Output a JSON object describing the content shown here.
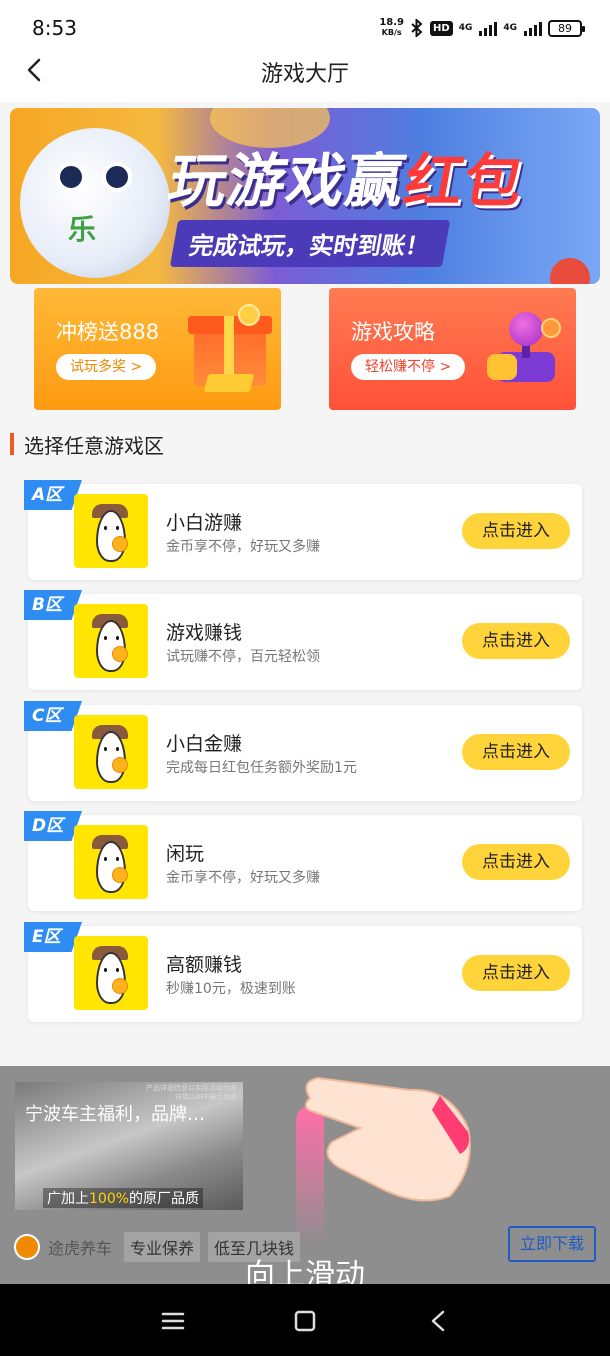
{
  "status_bar": {
    "time": "8:53",
    "net_speed_value": "18.9",
    "net_speed_unit": "KB/s",
    "hd_label": "HD",
    "sim1_label": "4G",
    "sim2_label": "4G",
    "battery": "89"
  },
  "nav": {
    "title": "游戏大厅",
    "back_icon": "chevron-left-icon"
  },
  "banner": {
    "title_part1": "玩游戏赢",
    "title_part2": "红包",
    "subtitle": "完成试玩，实时到账！",
    "mascot_text": "乐"
  },
  "promos": [
    {
      "title": "冲榜送888",
      "button": "试玩多奖 >"
    },
    {
      "title": "游戏攻略",
      "button": "轻松赚不停 >"
    }
  ],
  "section": {
    "title": "选择任意游戏区"
  },
  "zones": [
    {
      "badge": "A区",
      "name": "小白游赚",
      "desc": "金币享不停，好玩又多赚",
      "button": "点击进入"
    },
    {
      "badge": "B区",
      "name": "游戏赚钱",
      "desc": "试玩赚不停，百元轻松领",
      "button": "点击进入"
    },
    {
      "badge": "C区",
      "name": "小白金赚",
      "desc": "完成每日红包任务额外奖励1元",
      "button": "点击进入"
    },
    {
      "badge": "D区",
      "name": "闲玩",
      "desc": "金币享不停，好玩又多赚",
      "button": "点击进入"
    },
    {
      "badge": "E区",
      "name": "高额赚钱",
      "desc": "秒赚10元，极速到账",
      "button": "点击进入"
    }
  ],
  "ad": {
    "headline": "宁波车主福利，品牌…",
    "caption_prefix": "广加上",
    "caption_highlight": "100%",
    "caption_suffix": "的原厂品质",
    "fine_print_1": "产品详细信息以实际活动为准",
    "fine_print_2": "详情以APP展示为准",
    "brand": "途虎养车",
    "tags": [
      "专业保养",
      "低至几块钱"
    ],
    "download_button": "立即下载",
    "swipe_hint": "向上滑动"
  },
  "colors": {
    "accent_orange": "#f15a24",
    "zone_badge_blue": "#2f8cf2",
    "enter_button_yellow": "#ffd43b",
    "download_blue": "#1e5bc8"
  },
  "system_nav": {
    "menu_icon": "menu-icon",
    "home_icon": "home-square-icon",
    "back_icon": "back-triangle-icon"
  }
}
